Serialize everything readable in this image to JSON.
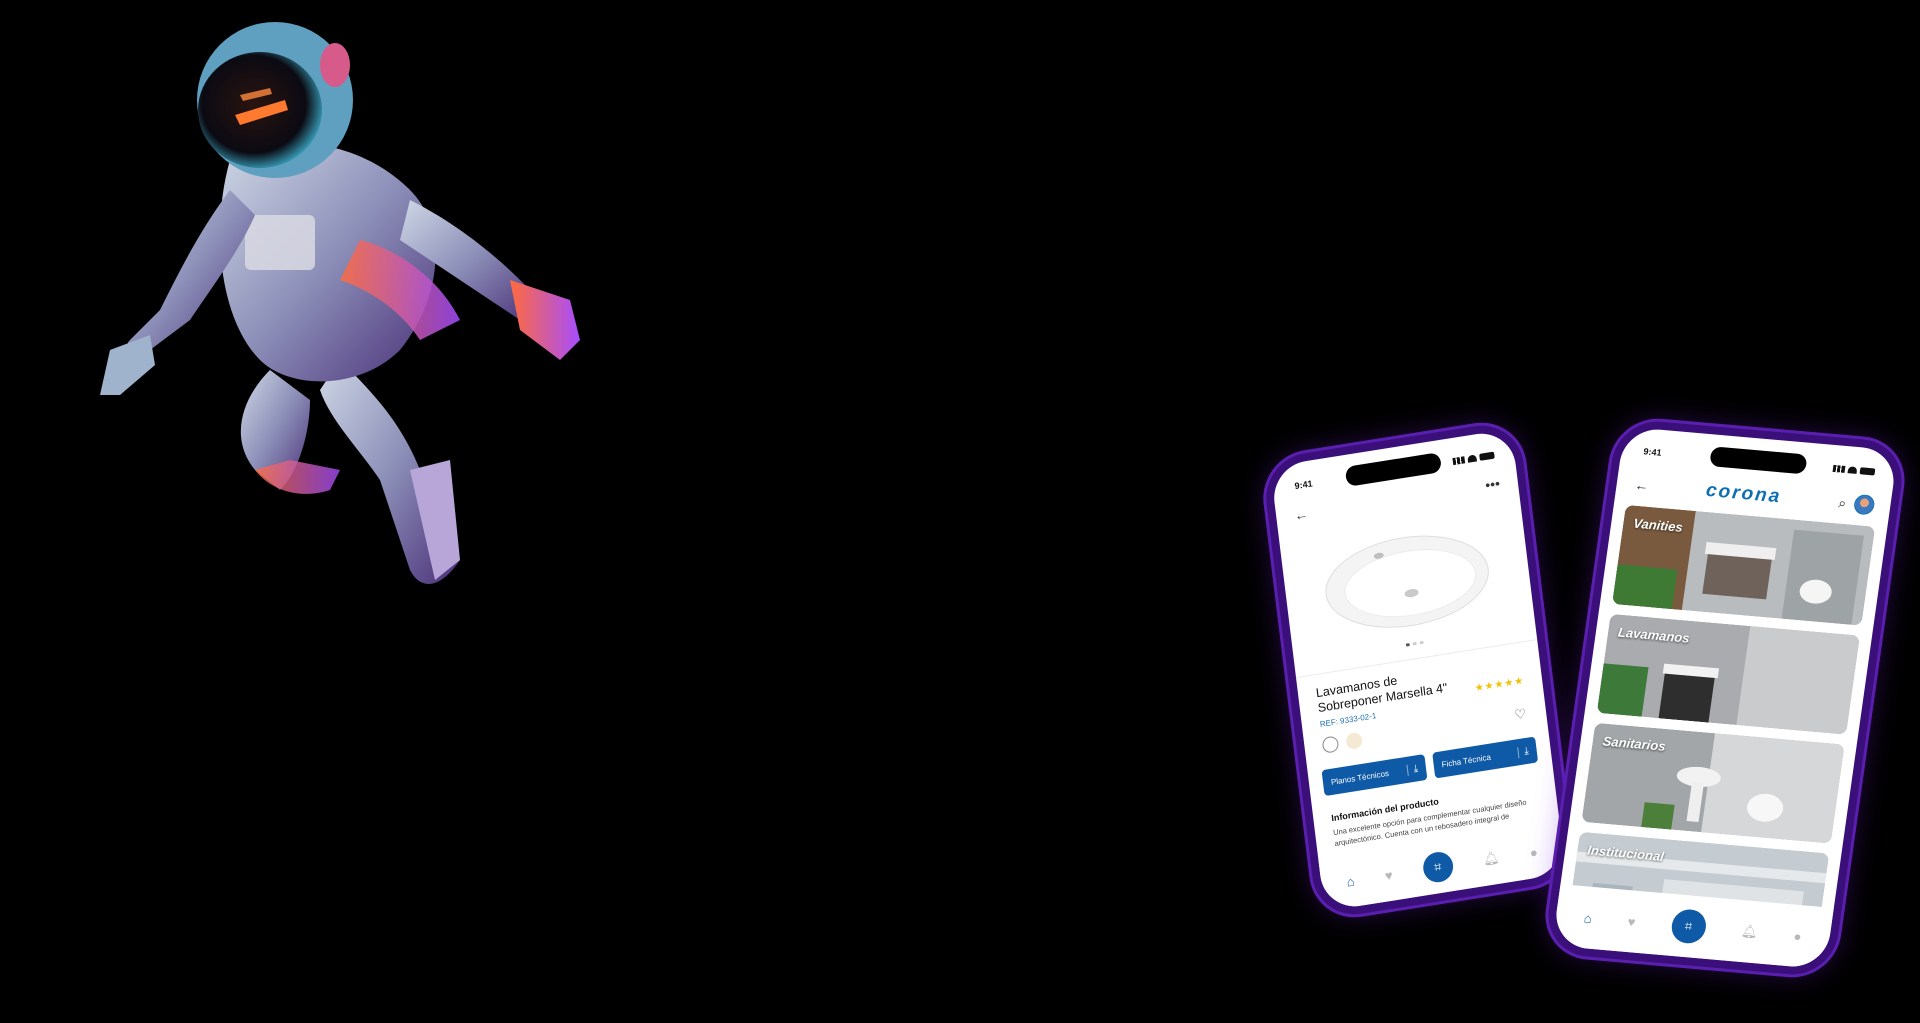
{
  "colors": {
    "background": "#000000",
    "brand_blue": "#0e5aa7",
    "phone_frame": "#5b1fb0",
    "star": "#f2c200"
  },
  "phone_product": {
    "status_time": "9:41",
    "back_icon": "arrow-left-icon",
    "more_icon": "more-horizontal-icon",
    "title": "Lavamanos de Sobreponer Marsella 4\"",
    "ref": "REF: 9333-02-1",
    "rating_stars": 5,
    "stars_text": "★★★★★",
    "planos_button": "Planos Técnicos",
    "ficha_button": "Ficha Técnica",
    "download_glyph": "⤓",
    "info_title": "Información del producto",
    "info_description": "Una excelente opción para complementar cualquier diseño arquitectónico. Cuenta con un rebosadero integral de",
    "tabs": [
      "home-icon",
      "heart-icon",
      "scan-icon",
      "bell-icon",
      "user-icon"
    ]
  },
  "phone_categories": {
    "status_time": "9:41",
    "brand": "corona",
    "back_icon": "arrow-left-icon",
    "search_icon": "search-icon",
    "categories": [
      {
        "label": "Vanities"
      },
      {
        "label": "Lavamanos"
      },
      {
        "label": "Sanitarios"
      },
      {
        "label": "Institucional"
      }
    ],
    "tabs": [
      "home-icon",
      "heart-icon",
      "scan-icon",
      "bell-icon",
      "user-icon"
    ]
  }
}
